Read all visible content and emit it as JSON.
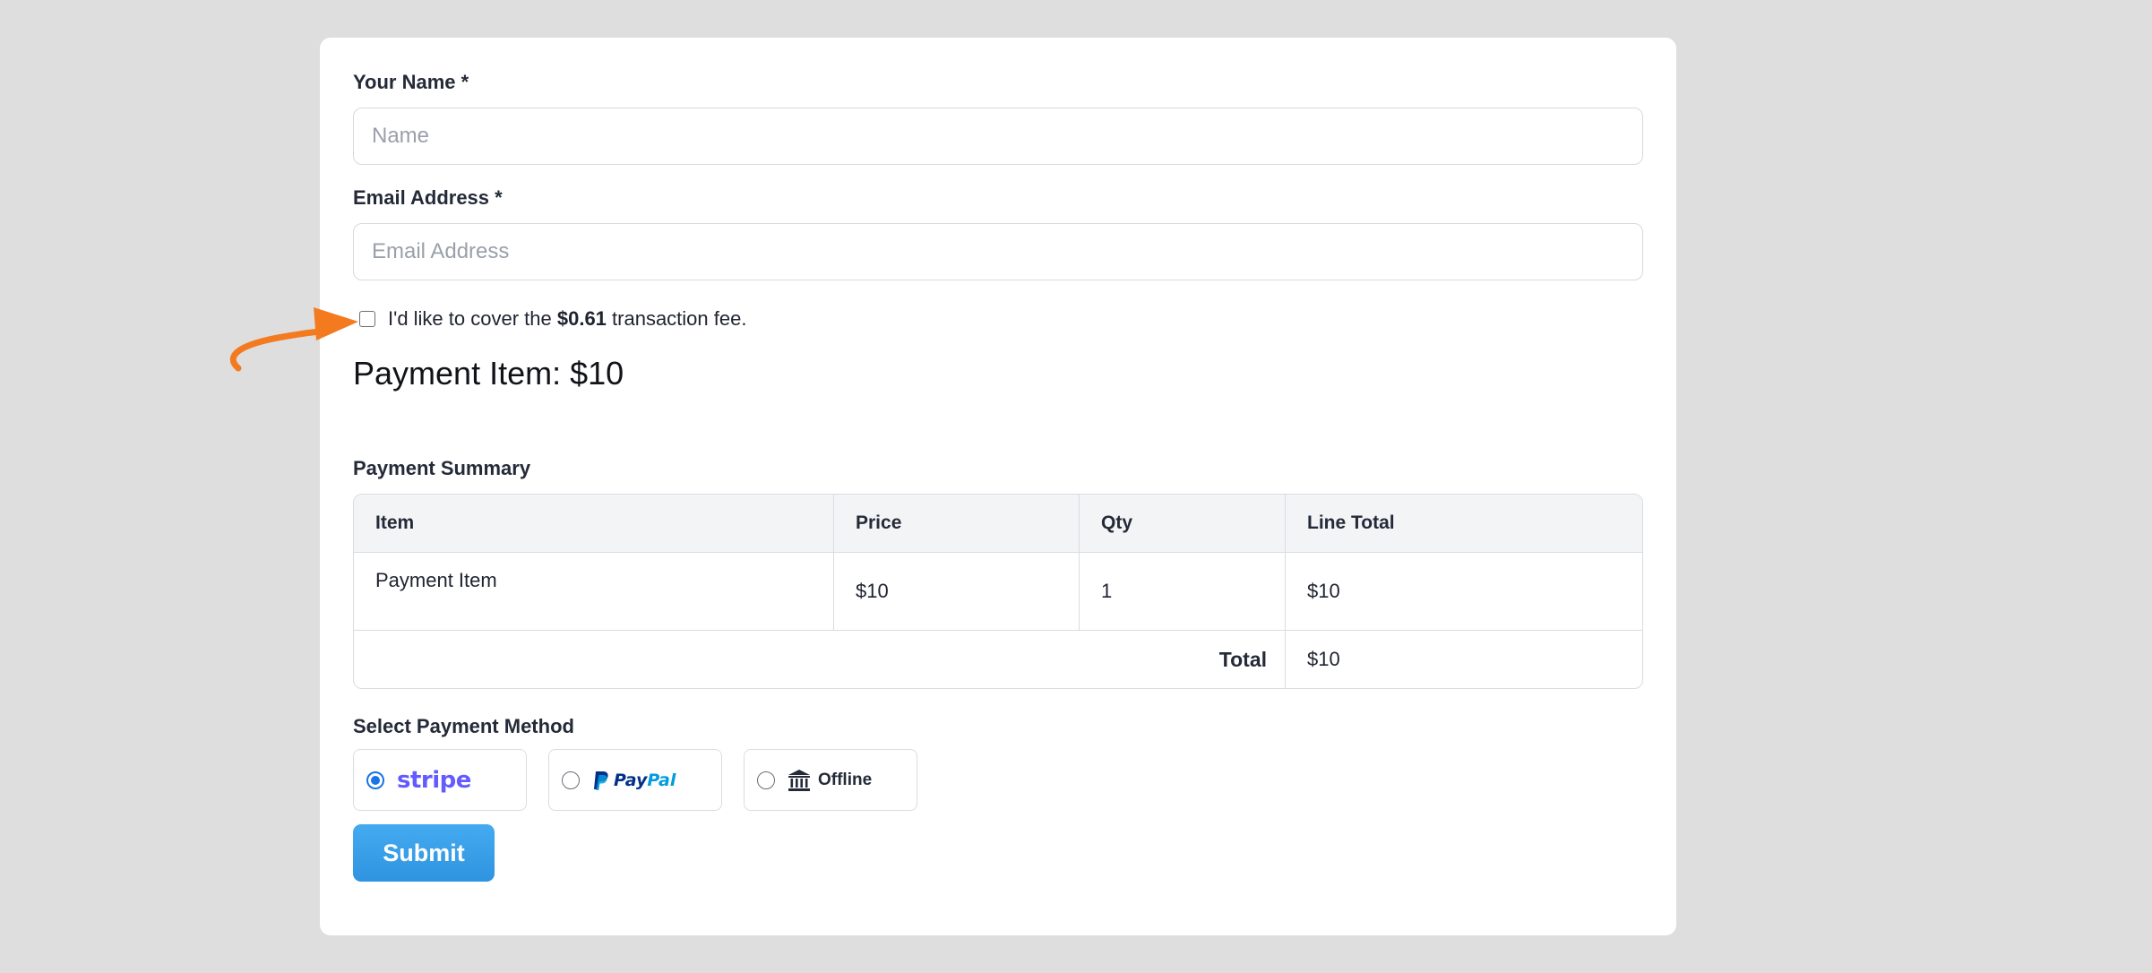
{
  "form": {
    "name": {
      "label": "Your Name *",
      "placeholder": "Name",
      "value": ""
    },
    "email": {
      "label": "Email Address *",
      "placeholder": "Email Address",
      "value": ""
    },
    "fee": {
      "prefix": "I'd like to cover the ",
      "amount": "$0.61",
      "suffix": " transaction fee.",
      "checked": false
    },
    "payment_item_heading": "Payment Item: $10",
    "summary": {
      "label": "Payment Summary",
      "headers": [
        "Item",
        "Price",
        "Qty",
        "Line Total"
      ],
      "rows": [
        {
          "item": "Payment Item",
          "price": "$10",
          "qty": "1",
          "line_total": "$10"
        }
      ],
      "total_label": "Total",
      "total_value": "$10"
    },
    "payment_method": {
      "label": "Select Payment Method",
      "selected": "stripe",
      "options": [
        {
          "id": "stripe",
          "logo_text": "stripe",
          "icon": "stripe-logo",
          "brand_color": "#635bff"
        },
        {
          "id": "paypal",
          "logo_text_1": "Pay",
          "logo_text_2": "Pal",
          "icon": "paypal-logo",
          "brand_color_1": "#003087",
          "brand_color_2": "#009cde"
        },
        {
          "id": "offline",
          "label": "Offline",
          "icon": "bank-icon"
        }
      ]
    },
    "submit_label": "Submit"
  },
  "colors": {
    "accent": "#1a73e8",
    "submit": "#3aa0e8",
    "annotation": "#f47a1f"
  }
}
